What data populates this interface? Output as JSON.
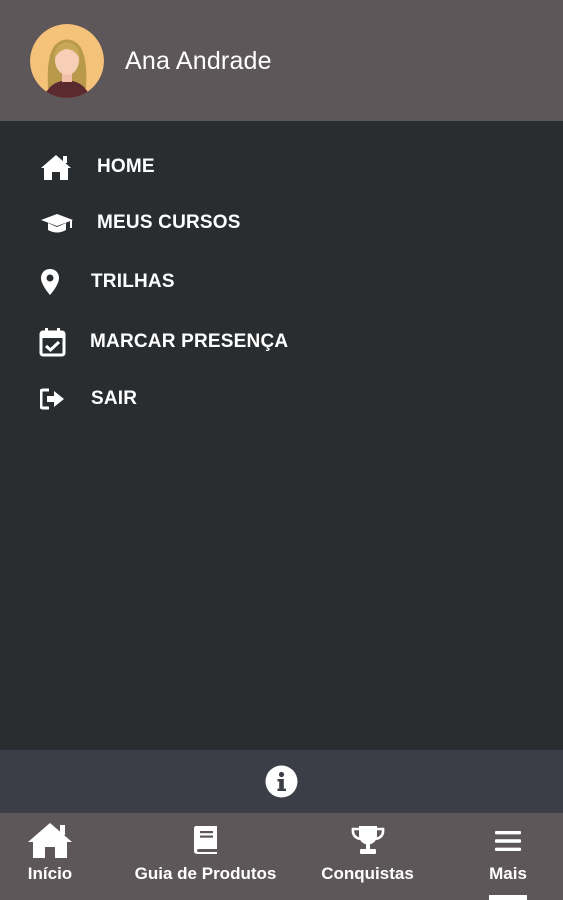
{
  "user": {
    "name": "Ana Andrade",
    "avatar_icon": "user-avatar-icon"
  },
  "menu": {
    "items": [
      {
        "label": "HOME",
        "icon": "home-icon"
      },
      {
        "label": "MEUS CURSOS",
        "icon": "graduation-cap-icon"
      },
      {
        "label": "TRILHAS",
        "icon": "map-pin-icon"
      },
      {
        "label": "MARCAR PRESENÇA",
        "icon": "calendar-check-icon"
      },
      {
        "label": "SAIR",
        "icon": "sign-out-icon"
      }
    ]
  },
  "info": {
    "icon": "info-icon"
  },
  "bottom_nav": {
    "items": [
      {
        "label": "Início",
        "icon": "home-icon"
      },
      {
        "label": "Guia de Produtos",
        "icon": "book-icon"
      },
      {
        "label": "Conquistas",
        "icon": "trophy-icon"
      },
      {
        "label": "Mais",
        "icon": "menu-icon",
        "active": true
      }
    ]
  },
  "colors": {
    "header_bg": "#5e5759",
    "drawer_bg": "#2a2d30",
    "info_bar_bg": "#3b3e46",
    "text": "#ffffff"
  }
}
